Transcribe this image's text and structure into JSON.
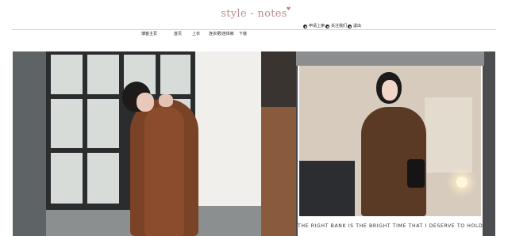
{
  "site": {
    "logo_text": "style - notes",
    "logo_mark": "heart-icon"
  },
  "nav": {
    "items": [
      {
        "label": "博客主頁"
      },
      {
        "label": "首页"
      },
      {
        "label": "上衣"
      },
      {
        "label": "连衣裙/连体裤"
      },
      {
        "label": "下装"
      }
    ]
  },
  "actions": [
    {
      "label": "申请上架",
      "icon": "circle-dot-icon"
    },
    {
      "label": "关注我们",
      "icon": "circle-dot-icon"
    },
    {
      "label": "退出",
      "icon": "circle-dot-icon"
    }
  ],
  "banner": {
    "caption": "THE RIGHT BANK IS THE BRIGHT TIME THAT I DESERVE TO HOLD"
  }
}
